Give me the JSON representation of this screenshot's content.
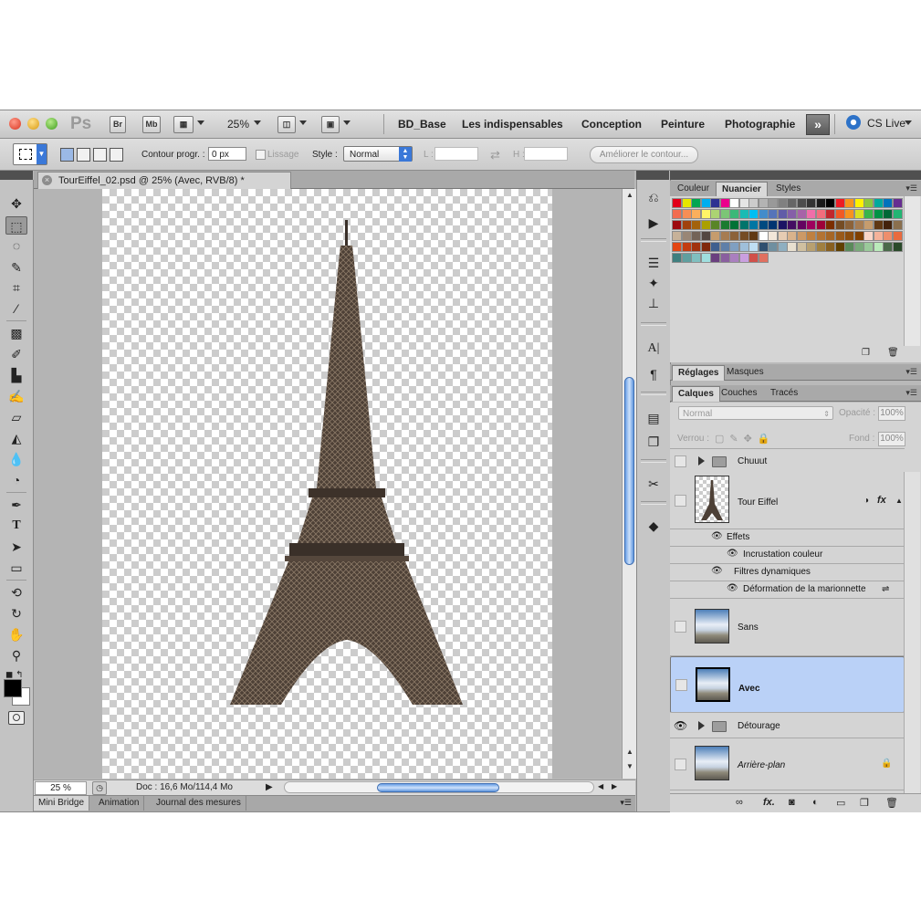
{
  "appbar": {
    "bridge_label": "Br",
    "minibridge_label": "Mb",
    "zoom": "25%",
    "workspaces": [
      "BD_Base",
      "Les indispensables",
      "Conception",
      "Peinture",
      "Photographie"
    ],
    "more_label": "»",
    "cs_live": "CS Live"
  },
  "options": {
    "feather_label": "Contour progr. :",
    "feather_value": "0 px",
    "antialias_label": "Lissage",
    "style_label": "Style :",
    "style_value": "Normal",
    "width_label": "L :",
    "height_label": "H :",
    "refine_label": "Améliorer le contour..."
  },
  "document": {
    "tab_title": "TourEiffel_02.psd @ 25% (Avec, RVB/8) *",
    "zoom_field": "25 %",
    "doc_info": "Doc : 16,6 Mo/114,4 Mo"
  },
  "bottom_tabs": [
    "Mini Bridge",
    "Animation",
    "Journal des mesures"
  ],
  "panels": {
    "top_tabs": [
      "Couleur",
      "Nuancier",
      "Styles"
    ],
    "mid_tabs": [
      "Réglages",
      "Masques"
    ],
    "layer_tabs": [
      "Calques",
      "Couches",
      "Tracés"
    ]
  },
  "layers_panel": {
    "blend_mode": "Normal",
    "opacity_label": "Opacité :",
    "opacity_value": "100%",
    "lock_label": "Verrou :",
    "fill_label": "Fond :",
    "fill_value": "100%",
    "layers": [
      {
        "name": "Chuuut",
        "kind": "group",
        "visible": false
      },
      {
        "name": "Tour Eiffel",
        "kind": "layer",
        "visible": false,
        "has_fx": true
      },
      {
        "name": "Sans",
        "kind": "layer",
        "visible": false
      },
      {
        "name": "Avec",
        "kind": "layer",
        "visible": false,
        "selected": true
      },
      {
        "name": "Détourage",
        "kind": "group",
        "visible": true
      },
      {
        "name": "Arrière-plan",
        "kind": "background",
        "visible": false,
        "locked": true
      }
    ],
    "effects_label": "Effets",
    "effect_item": "Incrustation couleur",
    "smart_filters_label": "Filtres dynamiques",
    "smart_filter_item": "Déformation de la marionnette"
  },
  "swatch_colors": [
    "#e2001a",
    "#e6e600",
    "#00a651",
    "#00aeef",
    "#2e3192",
    "#ec008c",
    "#ffffff",
    "#e5e5e5",
    "#cccccc",
    "#b3b3b3",
    "#999999",
    "#808080",
    "#666666",
    "#4d4d4d",
    "#333333",
    "#1a1a1a",
    "#000000",
    "#ed1c24",
    "#f7941d",
    "#fff200",
    "#8dc63f",
    "#00a99d",
    "#0072bc",
    "#662d91",
    "#f26c4f",
    "#f68e55",
    "#fbaf5c",
    "#fff467",
    "#acd372",
    "#7cc576",
    "#3bb878",
    "#1abbb4",
    "#00bff3",
    "#438ccb",
    "#5574b9",
    "#605ca8",
    "#855fa8",
    "#a763a8",
    "#f06ea9",
    "#f26d7d",
    "#c1272d",
    "#f15a24",
    "#f7931e",
    "#d9e021",
    "#39b54a",
    "#009245",
    "#006837",
    "#22b573",
    "#9e0b0f",
    "#a0410d",
    "#a3620a",
    "#aba000",
    "#598527",
    "#1a7b30",
    "#007236",
    "#00746b",
    "#0076a3",
    "#004a80",
    "#003471",
    "#1b1464",
    "#440e62",
    "#630460",
    "#9e005d",
    "#9e0039",
    "#7b2e00",
    "#754c24",
    "#8c6239",
    "#a67c52",
    "#c69c6d",
    "#603813",
    "#42210b",
    "#8a6f4e",
    "#c7b299",
    "#998675",
    "#736357",
    "#534741",
    "#c69c6d",
    "#a67c52",
    "#8c6239",
    "#754c24",
    "#603913",
    "#ffffff",
    "#f2e6d9",
    "#e6ccb3",
    "#d9b38c",
    "#cc9966",
    "#bf8040",
    "#b37333",
    "#a66626",
    "#995919",
    "#8c4d0d",
    "#804000",
    "#f9d6c8",
    "#f4b29a",
    "#ee8e6c",
    "#e96a3e",
    "#e34614",
    "#c23c11",
    "#a1320e",
    "#80280b",
    "#3f5f8f",
    "#5f7fa8",
    "#7f9fc1",
    "#9fbfda",
    "#bfdff3",
    "#2f4f6f",
    "#6f8fa0",
    "#8fafc0",
    "#e8e0d0",
    "#d0c0a0",
    "#b8a070",
    "#a08040",
    "#886020",
    "#604000",
    "#5a8a5a",
    "#7aaa7a",
    "#9aca9a",
    "#baeaba",
    "#4a6a4a",
    "#2a4a2a",
    "#3f7f7f",
    "#5f9f9f",
    "#7fbfbf",
    "#9fdfdf",
    "#6a3f7f",
    "#8a5f9f",
    "#aa7fbf",
    "#ca9fdf",
    "#d0504a",
    "#e07060"
  ]
}
